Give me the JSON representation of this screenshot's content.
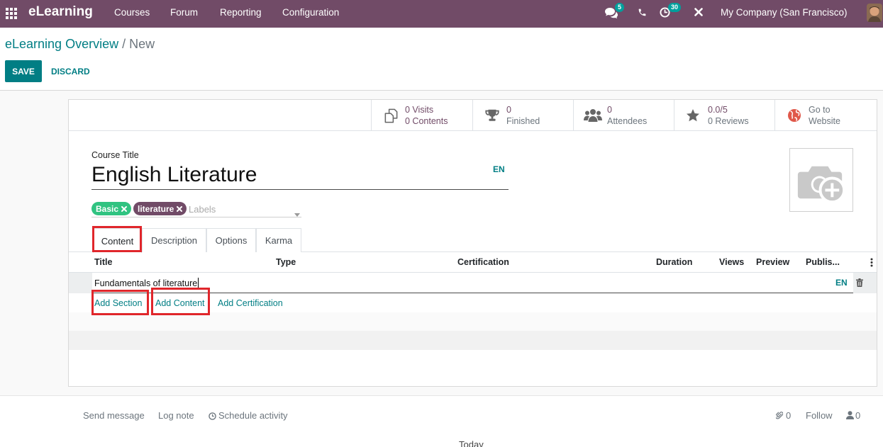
{
  "nav": {
    "apps_icon": "grid-icon",
    "app_name": "eLearning",
    "menu": [
      "Courses",
      "Forum",
      "Reporting",
      "Configuration"
    ],
    "messages_icon": "comments-icon",
    "messages_badge": "5",
    "phone_icon": "phone-icon",
    "activities_icon": "clock-icon",
    "activities_badge": "30",
    "debug_icon": "close-icon",
    "company": "My Company (San Francisco)",
    "avatar_icon": "user-avatar"
  },
  "breadcrumb": {
    "parent": "eLearning Overview",
    "separator": "/",
    "current": "New"
  },
  "actions": {
    "save": "SAVE",
    "discard": "DISCARD"
  },
  "stat_buttons": [
    {
      "icon": "copy-icon",
      "line1": "0 Visits",
      "line2": "0 Contents"
    },
    {
      "icon": "trophy-icon",
      "line1": "0",
      "line2": "Finished"
    },
    {
      "icon": "users-icon",
      "line1": "0",
      "line2": "Attendees"
    },
    {
      "icon": "star-icon",
      "line1": "0.0/5",
      "line2": "0 Reviews"
    },
    {
      "icon": "globe-icon",
      "line1": "Go to",
      "line2": "Website"
    }
  ],
  "course": {
    "title_label": "Course Title",
    "title": "English Literature",
    "title_lang": "EN",
    "image_icon": "camera-plus-icon",
    "tags": [
      {
        "label": "Basic",
        "color": "#30C381"
      },
      {
        "label": "literature",
        "color": "#714B67"
      }
    ],
    "tags_placeholder": "Labels"
  },
  "tabs": [
    {
      "label": "Content",
      "active": true
    },
    {
      "label": "Description",
      "active": false
    },
    {
      "label": "Options",
      "active": false
    },
    {
      "label": "Karma",
      "active": false
    }
  ],
  "content_table": {
    "columns": [
      "Title",
      "Type",
      "Certification",
      "Duration",
      "Views",
      "Preview",
      "Publis..."
    ],
    "rows": [
      {
        "title": "Fundamentals of literature",
        "lang": "EN"
      }
    ],
    "add_links": [
      "Add Section",
      "Add Content",
      "Add Certification"
    ]
  },
  "chatter": {
    "send_message": "Send message",
    "log_note": "Log note",
    "schedule_activity": "Schedule activity",
    "attachments_count": "0",
    "follow": "Follow",
    "followers_count": "0",
    "date_separator": "Today"
  },
  "colors": {
    "navbar": "#714B67",
    "primary": "#017E84",
    "badge": "#00A09D",
    "highlight": "#E0262B"
  }
}
